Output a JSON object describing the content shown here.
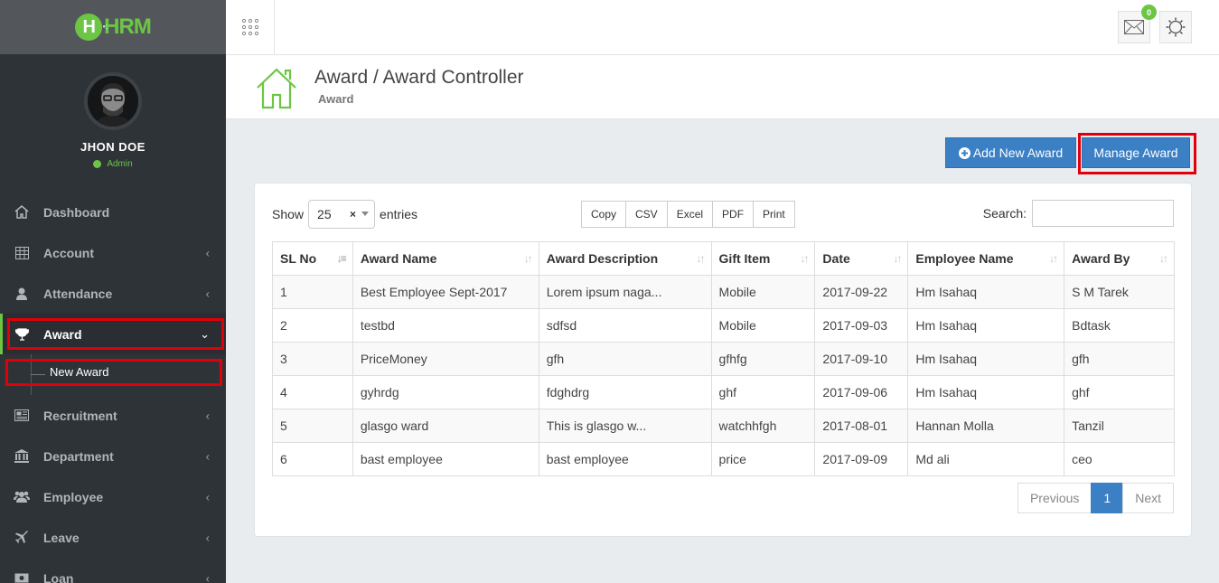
{
  "logo": {
    "text": "HRM",
    "mark": "H"
  },
  "profile": {
    "name": "JHON DOE",
    "role": "Admin"
  },
  "sidebar": {
    "items": [
      {
        "label": "Dashboard",
        "icon": "home-icon"
      },
      {
        "label": "Account",
        "icon": "table-icon"
      },
      {
        "label": "Attendance",
        "icon": "user-icon"
      },
      {
        "label": "Award",
        "icon": "trophy-icon"
      },
      {
        "label": "Recruitment",
        "icon": "newspaper-icon"
      },
      {
        "label": "Department",
        "icon": "bank-icon"
      },
      {
        "label": "Employee",
        "icon": "users-icon"
      },
      {
        "label": "Leave",
        "icon": "plane-icon"
      },
      {
        "label": "Loan",
        "icon": "money-icon"
      }
    ],
    "sub_award": "New Award"
  },
  "header": {
    "notifications_count": "0"
  },
  "page": {
    "title": "Award / Award Controller",
    "subtitle": "Award"
  },
  "actions": {
    "add_label": "Add New Award",
    "manage_label": "Manage Award"
  },
  "table_controls": {
    "show_label": "Show",
    "entries_value": "25",
    "entries_label": "entries",
    "export_buttons": [
      "Copy",
      "CSV",
      "Excel",
      "PDF",
      "Print"
    ],
    "search_label": "Search:"
  },
  "table": {
    "headers": [
      "SL No",
      "Award Name",
      "Award Description",
      "Gift Item",
      "Date",
      "Employee Name",
      "Award By"
    ],
    "rows": [
      [
        "1",
        "Best Employee Sept-2017",
        "Lorem ipsum naga...",
        "Mobile",
        "2017-09-22",
        "Hm Isahaq",
        "S M Tarek"
      ],
      [
        "2",
        "testbd",
        "sdfsd",
        "Mobile",
        "2017-09-03",
        "Hm Isahaq",
        "Bdtask"
      ],
      [
        "3",
        "PriceMoney",
        "gfh",
        "gfhfg",
        "2017-09-10",
        "Hm Isahaq",
        "gfh"
      ],
      [
        "4",
        "gyhrdg",
        "fdghdrg",
        "ghf",
        "2017-09-06",
        "Hm Isahaq",
        "ghf"
      ],
      [
        "5",
        "glasgo ward",
        "This is glasgo w...",
        "watchhfgh",
        "2017-08-01",
        "Hannan Molla",
        "Tanzil"
      ],
      [
        "6",
        "bast employee",
        "bast employee",
        "price",
        "2017-09-09",
        "Md ali",
        "ceo"
      ]
    ]
  },
  "pagination": {
    "previous": "Previous",
    "current": "1",
    "next": "Next"
  },
  "colors": {
    "accent_green": "#6cc644",
    "primary_blue": "#3b7fc4",
    "highlight_red": "#e0000b",
    "sidebar_bg": "#2e3338"
  }
}
